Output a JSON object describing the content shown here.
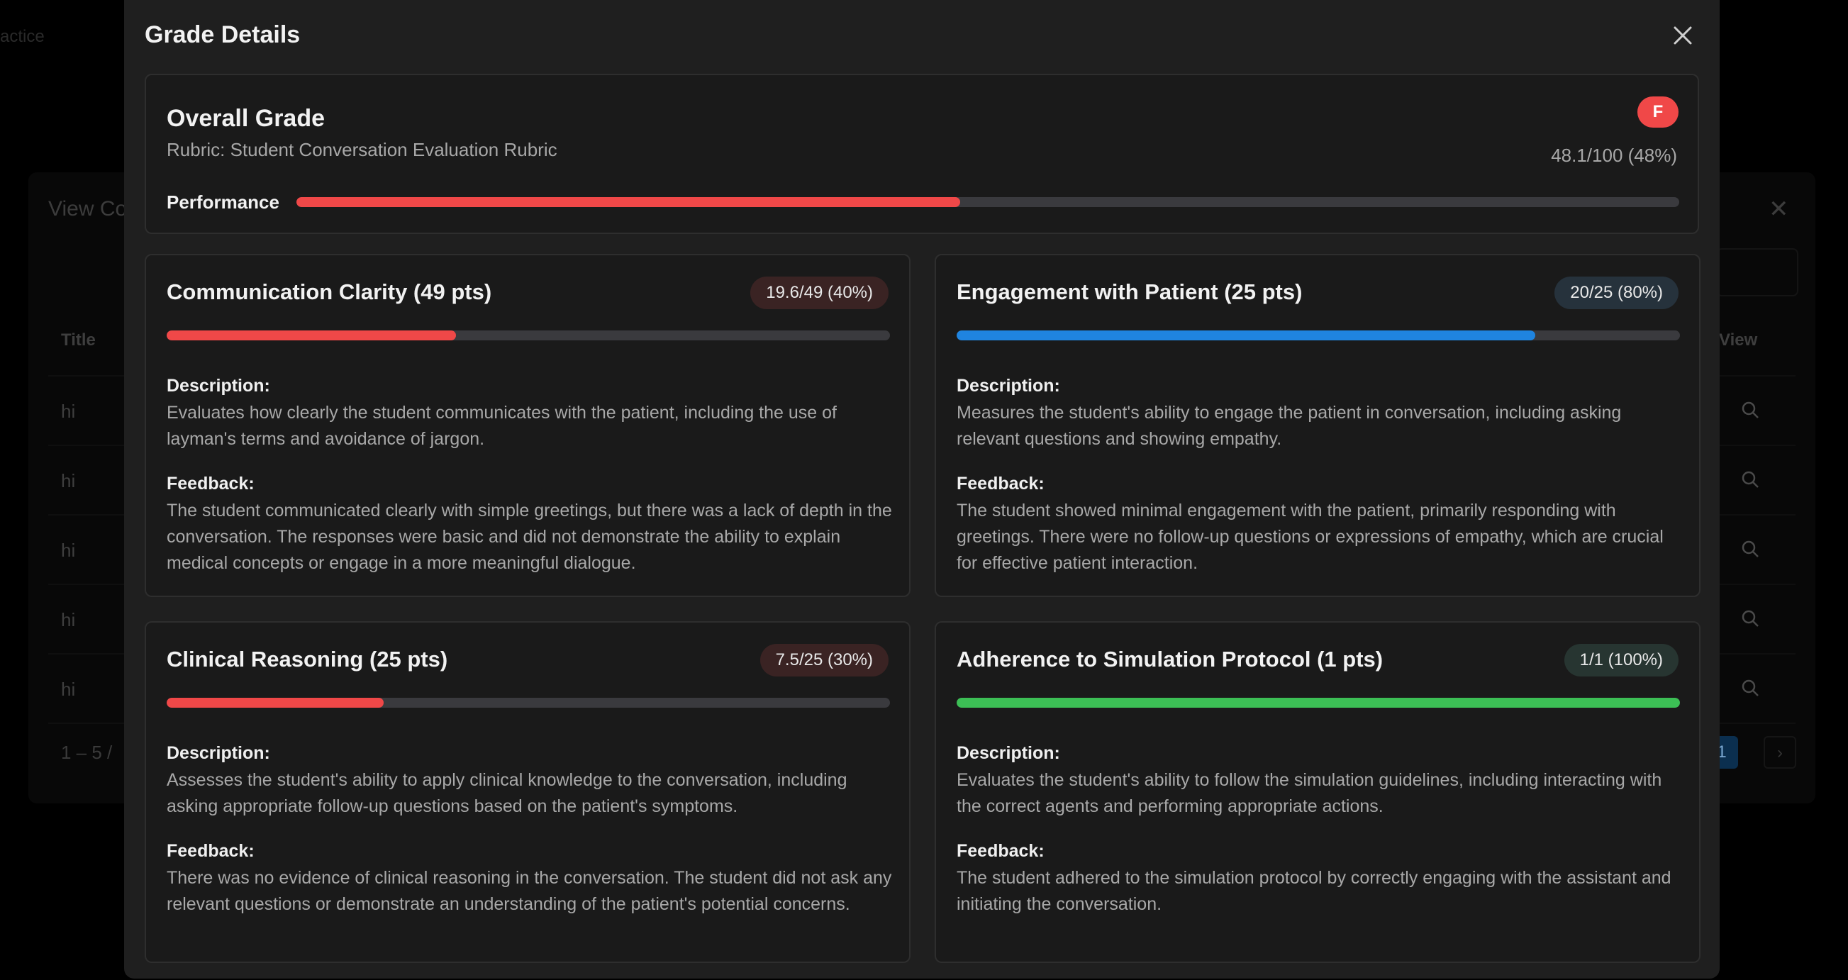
{
  "background": {
    "tab_text": "actice",
    "panel_title": "View Co",
    "columns": {
      "title": "Title",
      "view": "View"
    },
    "rows": [
      "hi",
      "hi",
      "hi",
      "hi",
      "hi"
    ],
    "pagination_text": "1 – 5 /",
    "current_page": "1",
    "next_icon": "chevron-right"
  },
  "modal": {
    "title": "Grade Details",
    "close_icon": "close-icon",
    "overall": {
      "title": "Overall Grade",
      "rubric": "Rubric: Student Conversation Evaluation Rubric",
      "grade_letter": "F",
      "score_text": "48.1/100 (48%)",
      "performance_label": "Performance",
      "percent": 48,
      "color": "#f04848"
    },
    "criteria": [
      {
        "name": "Communication Clarity (49 pts)",
        "score": "19.6/49 (40%)",
        "percent": 40,
        "color": "#f04848",
        "description_label": "Description:",
        "description": "Evaluates how clearly the student communicates with the patient, including the use of layman's terms and avoidance of jargon.",
        "feedback_label": "Feedback:",
        "feedback": "The student communicated clearly with simple greetings, but there was a lack of depth in the conversation. The responses were basic and did not demonstrate the ability to explain medical concepts or engage in a more meaningful dialogue."
      },
      {
        "name": "Engagement with Patient (25 pts)",
        "score": "20/25 (80%)",
        "percent": 80,
        "color": "#1f84e0",
        "description_label": "Description:",
        "description": "Measures the student's ability to engage the patient in conversation, including asking relevant questions and showing empathy.",
        "feedback_label": "Feedback:",
        "feedback": "The student showed minimal engagement with the patient, primarily responding with greetings. There were no follow-up questions or expressions of empathy, which are crucial for effective patient interaction."
      },
      {
        "name": "Clinical Reasoning (25 pts)",
        "score": "7.5/25 (30%)",
        "percent": 30,
        "color": "#f04848",
        "description_label": "Description:",
        "description": "Assesses the student's ability to apply clinical knowledge to the conversation, including asking appropriate follow-up questions based on the patient's symptoms.",
        "feedback_label": "Feedback:",
        "feedback": "There was no evidence of clinical reasoning in the conversation. The student did not ask any relevant questions or demonstrate an understanding of the patient's potential concerns."
      },
      {
        "name": "Adherence to Simulation Protocol (1 pts)",
        "score": "1/1 (100%)",
        "percent": 100,
        "color": "#3cbf55",
        "description_label": "Description:",
        "description": "Evaluates the student's ability to follow the simulation guidelines, including interacting with the correct agents and performing appropriate actions.",
        "feedback_label": "Feedback:",
        "feedback": "The student adhered to the simulation protocol by correctly engaging with the assistant and initiating the conversation."
      }
    ]
  }
}
